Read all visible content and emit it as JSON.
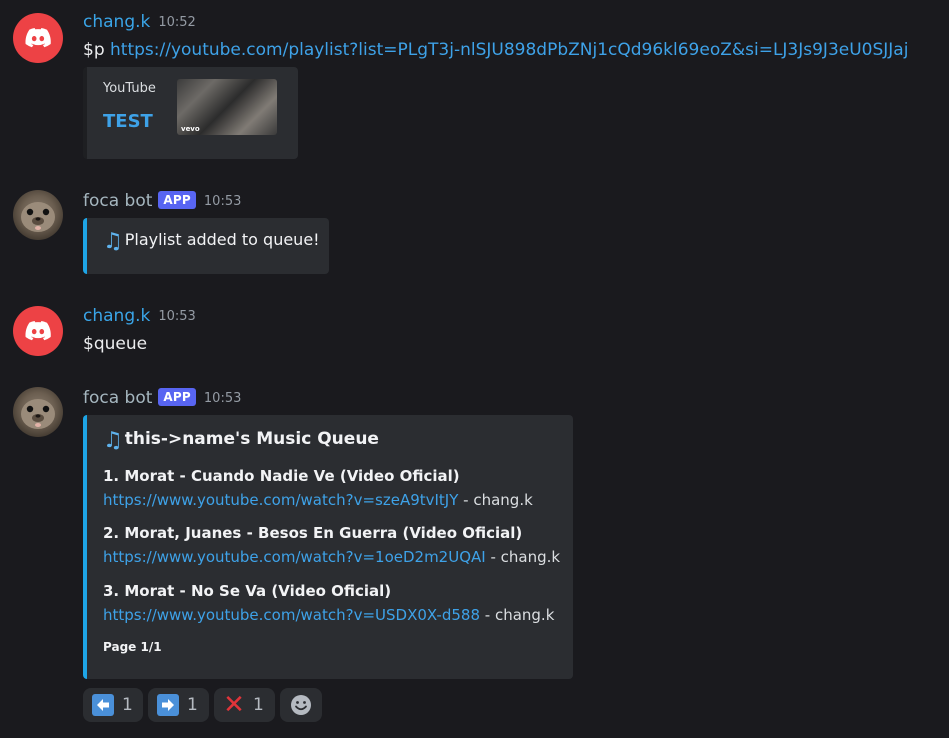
{
  "messages": [
    {
      "author": "chang.k",
      "timestamp": "10:52",
      "text_prefix": "$p ",
      "link": "https://youtube.com/playlist?list=PLgT3j-nlSJU898dPbZNj1cQd96kl69eoZ&si=LJ3Js9J3eU0SJJaj",
      "embed": {
        "provider": "YouTube",
        "title": "TEST",
        "thumb_watermark": "vevo"
      }
    },
    {
      "author": "foca bot",
      "badge": "APP",
      "timestamp": "10:53",
      "embed_text": "Playlist added to queue!"
    },
    {
      "author": "chang.k",
      "timestamp": "10:53",
      "text": "$queue"
    },
    {
      "author": "foca bot",
      "badge": "APP",
      "timestamp": "10:53",
      "queue": {
        "title": "this->name's Music Queue",
        "items": [
          {
            "name": "1. Morat - Cuando Nadie Ve (Video Oficial)",
            "url": "https://www.youtube.com/watch?v=szeA9tvItJY",
            "requester": " - chang.k"
          },
          {
            "name": "2. Morat, Juanes - Besos En Guerra (Video Oficial)",
            "url": "https://www.youtube.com/watch?v=1oeD2m2UQAI",
            "requester": " - chang.k"
          },
          {
            "name": "3. Morat - No Se Va (Video Oficial)",
            "url": "https://www.youtube.com/watch?v=USDX0X-d588",
            "requester": " - chang.k"
          }
        ],
        "page": "Page 1/1"
      },
      "reactions": [
        {
          "icon": "left-arrow-icon",
          "count": "1"
        },
        {
          "icon": "right-arrow-icon",
          "count": "1"
        },
        {
          "icon": "cross-mark-icon",
          "count": "1"
        }
      ]
    }
  ],
  "colors": {
    "background": "#1a1a1e",
    "link": "#3ea2e8",
    "embed_accent": "#1ea5e6",
    "badge": "#5865f2",
    "discord_red": "#ed4245"
  }
}
